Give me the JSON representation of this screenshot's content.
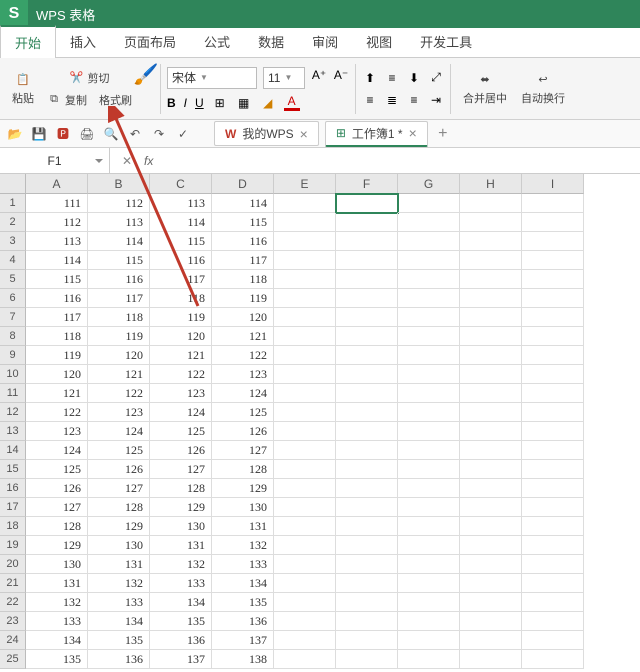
{
  "title": {
    "app": "WPS 表格"
  },
  "menu": {
    "tabs": [
      "开始",
      "插入",
      "页面布局",
      "公式",
      "数据",
      "审阅",
      "视图",
      "开发工具"
    ],
    "active": 0
  },
  "ribbon": {
    "cut": "剪切",
    "copy": "复制",
    "paste": "粘贴",
    "formatPainter": "格式刷",
    "font": "宋体",
    "size": "11",
    "merge": "合并居中",
    "wrap": "自动换行"
  },
  "qat_tabs": {
    "mywps": "我的WPS",
    "workbook": "工作簿1 *"
  },
  "nameBox": "F1",
  "columns": [
    "A",
    "B",
    "C",
    "D",
    "E",
    "F",
    "G",
    "H",
    "I"
  ],
  "rows": 25,
  "selectedCell": {
    "row": 0,
    "col": 5
  },
  "data": [
    [
      111,
      112,
      113,
      114
    ],
    [
      112,
      113,
      114,
      115
    ],
    [
      113,
      114,
      115,
      116
    ],
    [
      114,
      115,
      116,
      117
    ],
    [
      115,
      116,
      117,
      118
    ],
    [
      116,
      117,
      118,
      119
    ],
    [
      117,
      118,
      119,
      120
    ],
    [
      118,
      119,
      120,
      121
    ],
    [
      119,
      120,
      121,
      122
    ],
    [
      120,
      121,
      122,
      123
    ],
    [
      121,
      122,
      123,
      124
    ],
    [
      122,
      123,
      124,
      125
    ],
    [
      123,
      124,
      125,
      126
    ],
    [
      124,
      125,
      126,
      127
    ],
    [
      125,
      126,
      127,
      128
    ],
    [
      126,
      127,
      128,
      129
    ],
    [
      127,
      128,
      129,
      130
    ],
    [
      128,
      129,
      130,
      131
    ],
    [
      129,
      130,
      131,
      132
    ],
    [
      130,
      131,
      132,
      133
    ],
    [
      131,
      132,
      133,
      134
    ],
    [
      132,
      133,
      134,
      135
    ],
    [
      133,
      134,
      135,
      136
    ],
    [
      134,
      135,
      136,
      137
    ],
    [
      135,
      136,
      137,
      138
    ]
  ]
}
